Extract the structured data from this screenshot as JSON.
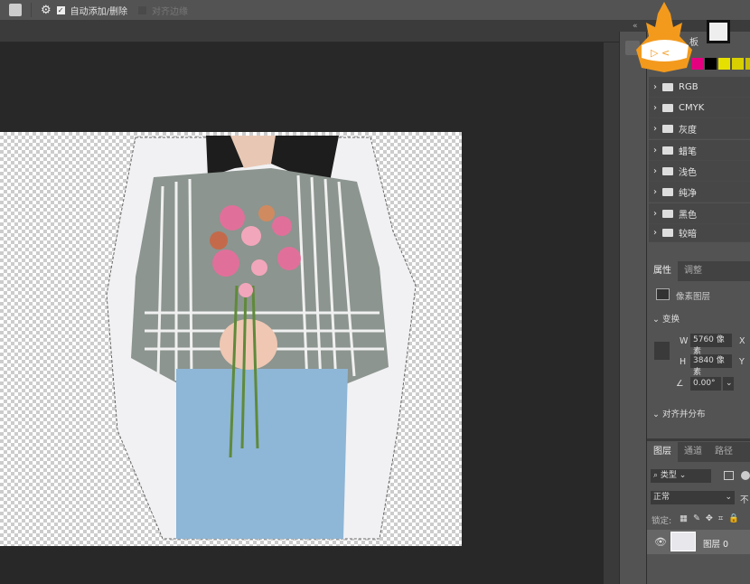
{
  "options_bar": {
    "tool_icon": "pen-add-icon",
    "settings_icon": "gear-icon",
    "auto_add_delete_label": "自动添加/删除",
    "auto_add_delete_checked": true,
    "align_edges_label": "对齐边缘",
    "align_edges_checked": false
  },
  "swatches": {
    "tab_label": "板",
    "colors": [
      "#e4007f",
      "#000000",
      "#e6e000",
      "#d8d000",
      "#c8c000"
    ],
    "groups": [
      "RGB",
      "CMYK",
      "灰度",
      "蜡笔",
      "浅色",
      "纯净",
      "黑色",
      "较暗"
    ]
  },
  "properties": {
    "tabs": [
      "属性",
      "调整"
    ],
    "layer_type": "像素图层",
    "transform_label": "变换",
    "w_label": "W",
    "w_value": "5760 像素",
    "h_label": "H",
    "h_value": "3840 像素",
    "x_label": "X",
    "y_label": "Y",
    "angle_value": "0.00°",
    "align_label": "对齐并分布"
  },
  "layers": {
    "tabs": [
      "图层",
      "通道",
      "路径"
    ],
    "filter_value": "类型",
    "blend_mode": "正常",
    "opacity_label": "不",
    "lock_label": "锁定:",
    "layer_name": "图层 0"
  },
  "watermark": "logo"
}
